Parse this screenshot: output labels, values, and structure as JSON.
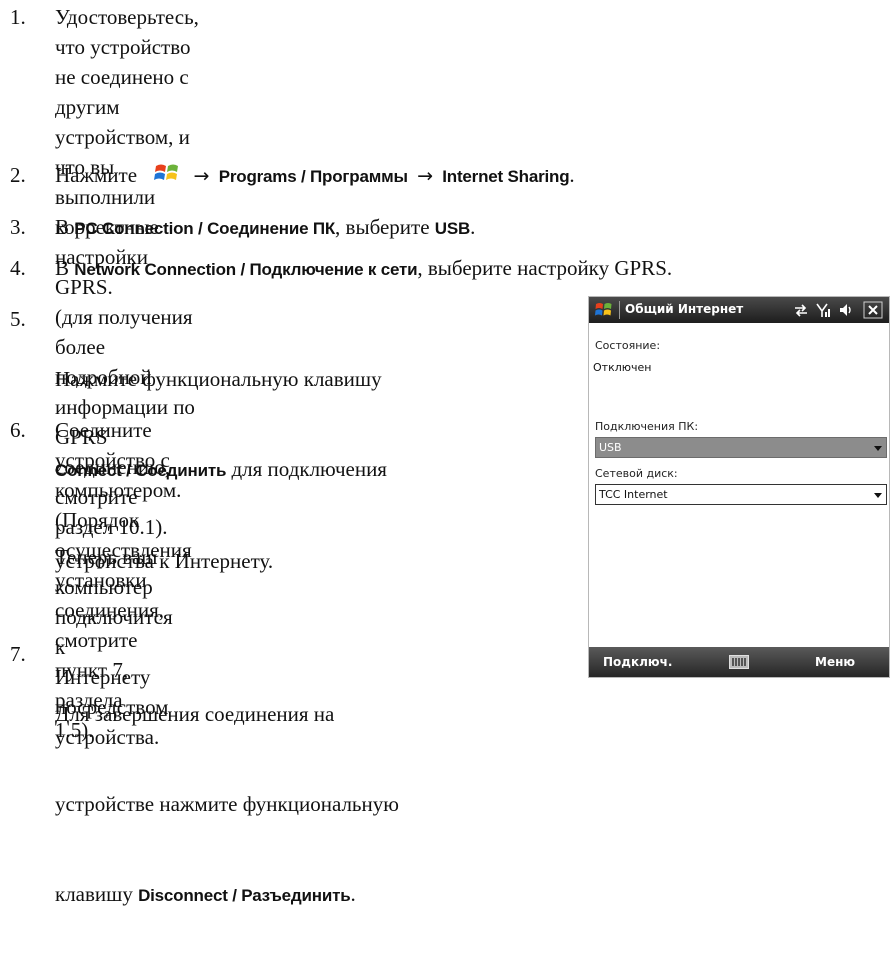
{
  "steps": [
    {
      "num": "1.",
      "lines": [
        "Удостоверьтесь, что устройство не соединено с другим",
        "устройством, и что вы выполнили корректные настройки GPRS.",
        "(для получения более подробной информации по GPRS",
        "соединению, смотрите раздел 10.1)."
      ]
    },
    {
      "num": "2.",
      "pre": "Нажмите",
      "path1": "Programs / Программы",
      "path2": "Internet Sharing",
      "post": "."
    },
    {
      "num": "3.",
      "pre": "В ",
      "bold": "PC Connection / Соединение ПК",
      "mid": ", выберите ",
      "bold2": "USB",
      "post": "."
    },
    {
      "num": "4.",
      "pre": "В ",
      "bold": "Network Connection / Подключение к сети",
      "post": ", выберите настройку GPRS."
    },
    {
      "num": "5.",
      "line1": "Нажмите функциональную клавишу",
      "bold": "Connect / Соединить",
      "line2rest": " для подключения",
      "line3": "устройства к Интернету."
    },
    {
      "num": "6.",
      "lines": [
        "Соедините устройство с компьютером.",
        "(Порядок осуществления установки",
        "соединения, смотрите пункт 7, раздела",
        "1.5)."
      ]
    },
    {
      "para": [
        "Теперь ваш компьютер подключится к",
        "Интернету посредством устройства."
      ]
    },
    {
      "num": "7.",
      "line1": "Для завершения соединения на",
      "line2": "устройстве нажмите функциональную",
      "line3pre": "клавишу ",
      "bold": "Disconnect / Разъединить",
      "post": "."
    }
  ],
  "arrow": "→",
  "device": {
    "title": "Общий Интернет",
    "status_label": "Состояние:",
    "status_value": "Отключен",
    "pc_label": "Подключения ПК:",
    "pc_value": "USB",
    "net_label": "Сетевой диск:",
    "net_value": "TCC Internet",
    "left_softkey": "Подключ.",
    "right_softkey": "Меню",
    "icons": [
      "windows-flag-icon",
      "connectivity-icon",
      "signal-icon",
      "volume-icon",
      "close-icon",
      "keyboard-icon",
      "dropdown-caret-icon"
    ]
  }
}
